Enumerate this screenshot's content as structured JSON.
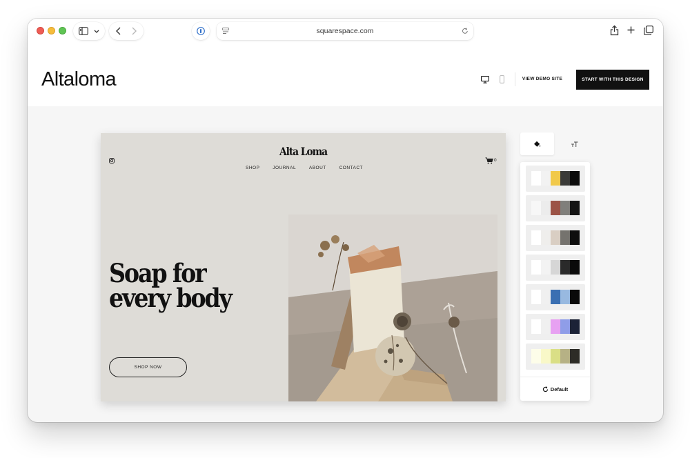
{
  "browser": {
    "url": "squarespace.com"
  },
  "header": {
    "brand": "Altaloma",
    "view_demo_label": "VIEW DEMO SITE",
    "start_label": "START WITH THIS DESIGN"
  },
  "preview": {
    "logo": "Alta Loma",
    "nav": [
      "SHOP",
      "JOURNAL",
      "ABOUT",
      "CONTACT"
    ],
    "cart_count": "0",
    "headline": "Soap for  every body",
    "shop_button": "SHOP NOW"
  },
  "panel": {
    "tab_colors_icon": "paint-bucket-icon",
    "tab_fonts_icon": "font-size-icon",
    "default_label": "Default",
    "palettes": [
      [
        "#ffffff",
        "#f2f2f2",
        "#f1c94a",
        "#3a3a38",
        "#0c0c0c"
      ],
      [
        "#f7f7f7",
        "#ececec",
        "#9c5346",
        "#807f7b",
        "#141414"
      ],
      [
        "#ffffff",
        "#efeeec",
        "#d9cec3",
        "#75736e",
        "#0e0e0e"
      ],
      [
        "#ffffff",
        "#f3f3f3",
        "#d6d6d6",
        "#2a2a2a",
        "#0a0a0a"
      ],
      [
        "#ffffff",
        "#f0f0f0",
        "#3a6fb2",
        "#98b9e0",
        "#0a0a0a"
      ],
      [
        "#ffffff",
        "#f0f0f0",
        "#e7a1f2",
        "#8f9de8",
        "#1c2237"
      ],
      [
        "#fdfde9",
        "#f9f8c8",
        "#dadf86",
        "#b6b185",
        "#2d2c27"
      ]
    ]
  }
}
